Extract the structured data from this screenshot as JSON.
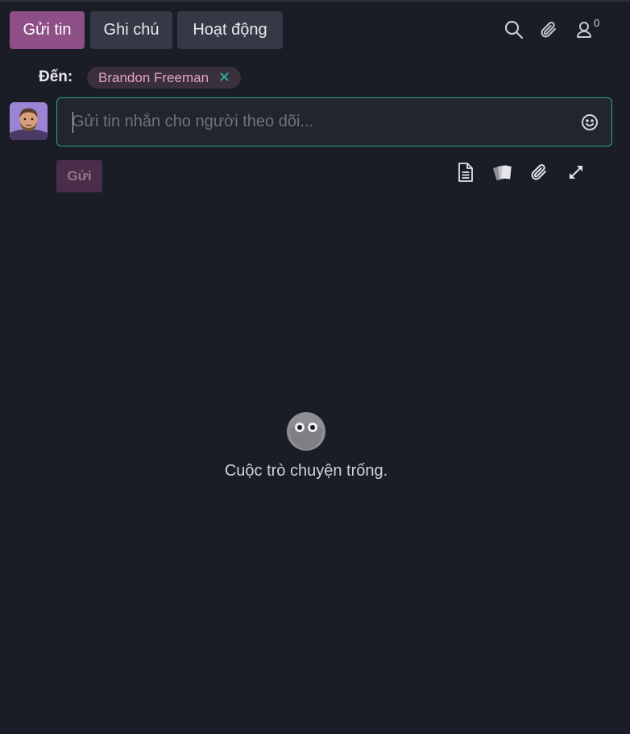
{
  "tabs": {
    "send_message": "Gửi tin",
    "log_note": "Ghi chú",
    "activity": "Hoạt động"
  },
  "top_icons": {
    "search": "search-icon",
    "attachment": "paperclip-icon",
    "followers": "user-icon",
    "followers_count": "0"
  },
  "recipients": {
    "label": "Đến:",
    "items": [
      {
        "name": "Brandon Freeman",
        "remove_icon": "close-icon"
      }
    ]
  },
  "composer": {
    "placeholder": "Gửi tin nhắn cho người theo dõi...",
    "value": "",
    "emoji_icon": "smiley-icon"
  },
  "actions": {
    "send_label": "Gửi",
    "tools": [
      "document-icon",
      "cards-icon",
      "paperclip-icon",
      "expand-icon"
    ]
  },
  "empty_state": {
    "icon": "owl-icon",
    "message": "Cuộc trò chuyện trống."
  },
  "colors": {
    "background": "#1b1d26",
    "primary": "#8e4f86",
    "secondary_button": "#353845",
    "focus_border": "#2aa394",
    "recipient_chip": "#3a2f3c",
    "recipient_text": "#e6a3c9"
  }
}
